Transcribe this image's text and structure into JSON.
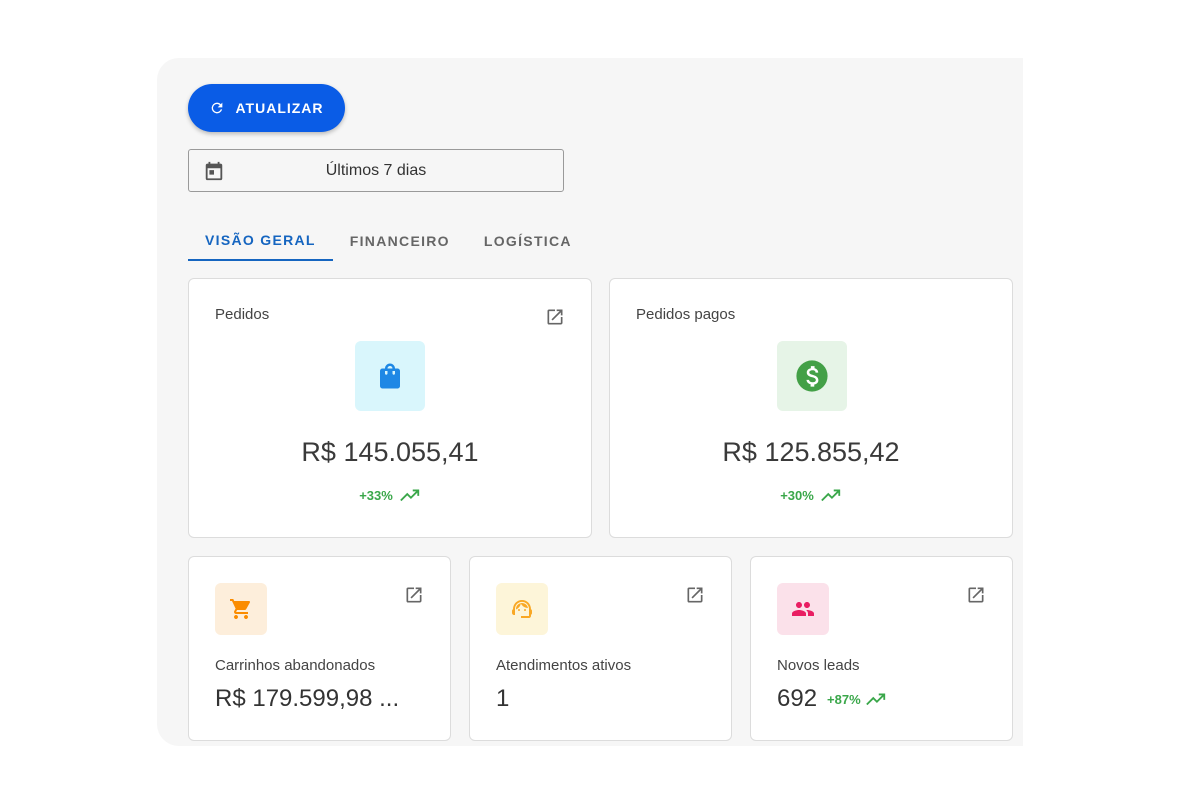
{
  "toolbar": {
    "refresh_label": "ATUALIZAR"
  },
  "date_filter": {
    "value": "Últimos 7 dias"
  },
  "tabs": [
    {
      "label": "VISÃO GERAL",
      "active": true
    },
    {
      "label": "FINANCEIRO",
      "active": false
    },
    {
      "label": "LOGÍSTICA",
      "active": false
    }
  ],
  "cards": {
    "pedidos": {
      "title": "Pedidos",
      "value": "R$ 145.055,41",
      "trend": "+33%",
      "icon": "shopping-bag-icon",
      "icon_color": "#1e88e5",
      "icon_bg": "#d9f6fc"
    },
    "pedidos_pagos": {
      "title": "Pedidos pagos",
      "value": "R$ 125.855,42",
      "trend": "+30%",
      "icon": "dollar-icon",
      "icon_color": "#43a047",
      "icon_bg": "#e6f4e7"
    },
    "carrinhos": {
      "title": "Carrinhos abandonados",
      "value": "R$ 179.599,98 ...",
      "icon": "cart-icon",
      "icon_color": "#fb8c00",
      "icon_bg": "#fdeedb"
    },
    "atendimentos": {
      "title": "Atendimentos ativos",
      "value": "1",
      "icon": "support-agent-icon",
      "icon_color": "#f9a825",
      "icon_bg": "#fdf5d9"
    },
    "leads": {
      "title": "Novos leads",
      "value": "692",
      "trend": "+87%",
      "icon": "people-icon",
      "icon_color": "#e91e63",
      "icon_bg": "#fbe1ea"
    }
  },
  "colors": {
    "accent": "#0a5ce6",
    "tab_active": "#1565c0",
    "trend_up": "#3aa74a"
  }
}
